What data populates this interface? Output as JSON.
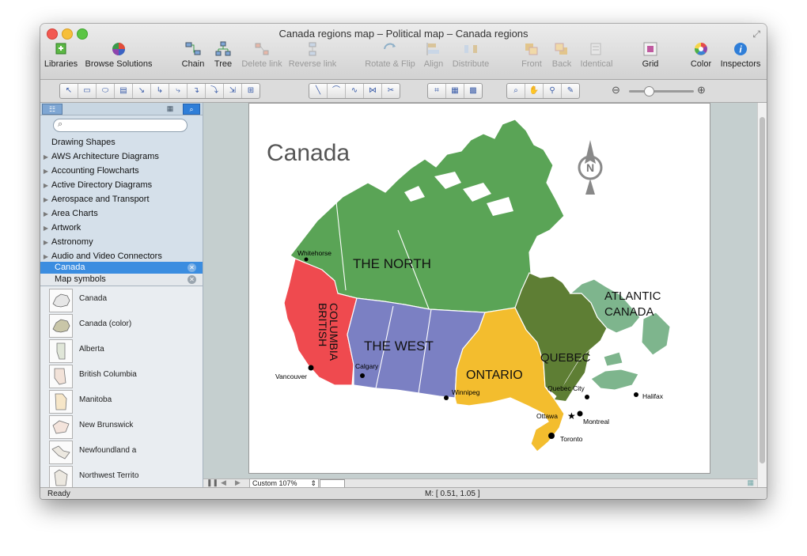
{
  "window": {
    "title": "Canada regions map – Political map – Canada regions"
  },
  "toolbar": {
    "libraries": "Libraries",
    "browse_solutions": "Browse Solutions",
    "chain": "Chain",
    "tree": "Tree",
    "delete_link": "Delete link",
    "reverse_link": "Reverse link",
    "rotate_flip": "Rotate & Flip",
    "align": "Align",
    "distribute": "Distribute",
    "front": "Front",
    "back": "Back",
    "identical": "Identical",
    "grid": "Grid",
    "color": "Color",
    "inspectors": "Inspectors"
  },
  "library_panel": {
    "categories": [
      "Drawing Shapes",
      "AWS Architecture Diagrams",
      "Accounting Flowcharts",
      "Active Directory Diagrams",
      "Aerospace and Transport",
      "Area Charts",
      "Artwork",
      "Astronomy",
      "Audio and Video Connectors"
    ],
    "open_libraries": [
      "Canada",
      "Map symbols"
    ],
    "shapes": [
      "Canada",
      "Canada (color)",
      "Alberta",
      "British Columbia",
      "Manitoba",
      "New Brunswick",
      "Newfoundland a",
      "Northwest Territo"
    ]
  },
  "map": {
    "title": "Canada",
    "compass_letter": "N",
    "regions": {
      "north": "THE NORTH",
      "west": "THE WEST",
      "bc_line1": "BRITISH",
      "bc_line2": "COLUMBIA",
      "ontario": "ONTARIO",
      "quebec": "QUEBEC",
      "atlantic_line1": "ATLANTIC",
      "atlantic_line2": "CANADA"
    },
    "cities": {
      "whitehorse": "Whitehorse",
      "vancouver": "Vancouver",
      "calgary": "Calgary",
      "winnipeg": "Winnipeg",
      "quebec_city": "Quebec City",
      "ottawa": "Ottawa",
      "montreal": "Montreal",
      "toronto": "Toronto",
      "halifax": "Halifax"
    },
    "colors": {
      "north": "#5aa456",
      "bc": "#ef4a4f",
      "west": "#7b80c3",
      "ontario": "#f3bd2e",
      "quebec": "#5e7e34",
      "atlantic": "#7eb58d"
    }
  },
  "zoom": {
    "label": "Custom 107%"
  },
  "status": {
    "ready": "Ready",
    "mouse": "M: [ 0.51, 1.05 ]"
  }
}
